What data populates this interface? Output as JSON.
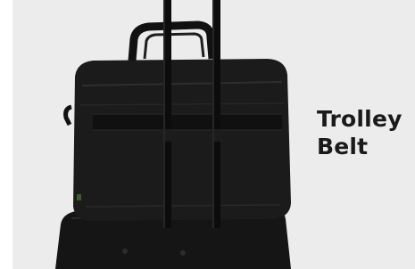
{
  "caption": {
    "line1": "Trolley",
    "line2": "Belt"
  },
  "colors": {
    "background": "#ececec",
    "bag": "#181818",
    "handle": "#0d0d0d",
    "text": "#1a1a1a"
  }
}
